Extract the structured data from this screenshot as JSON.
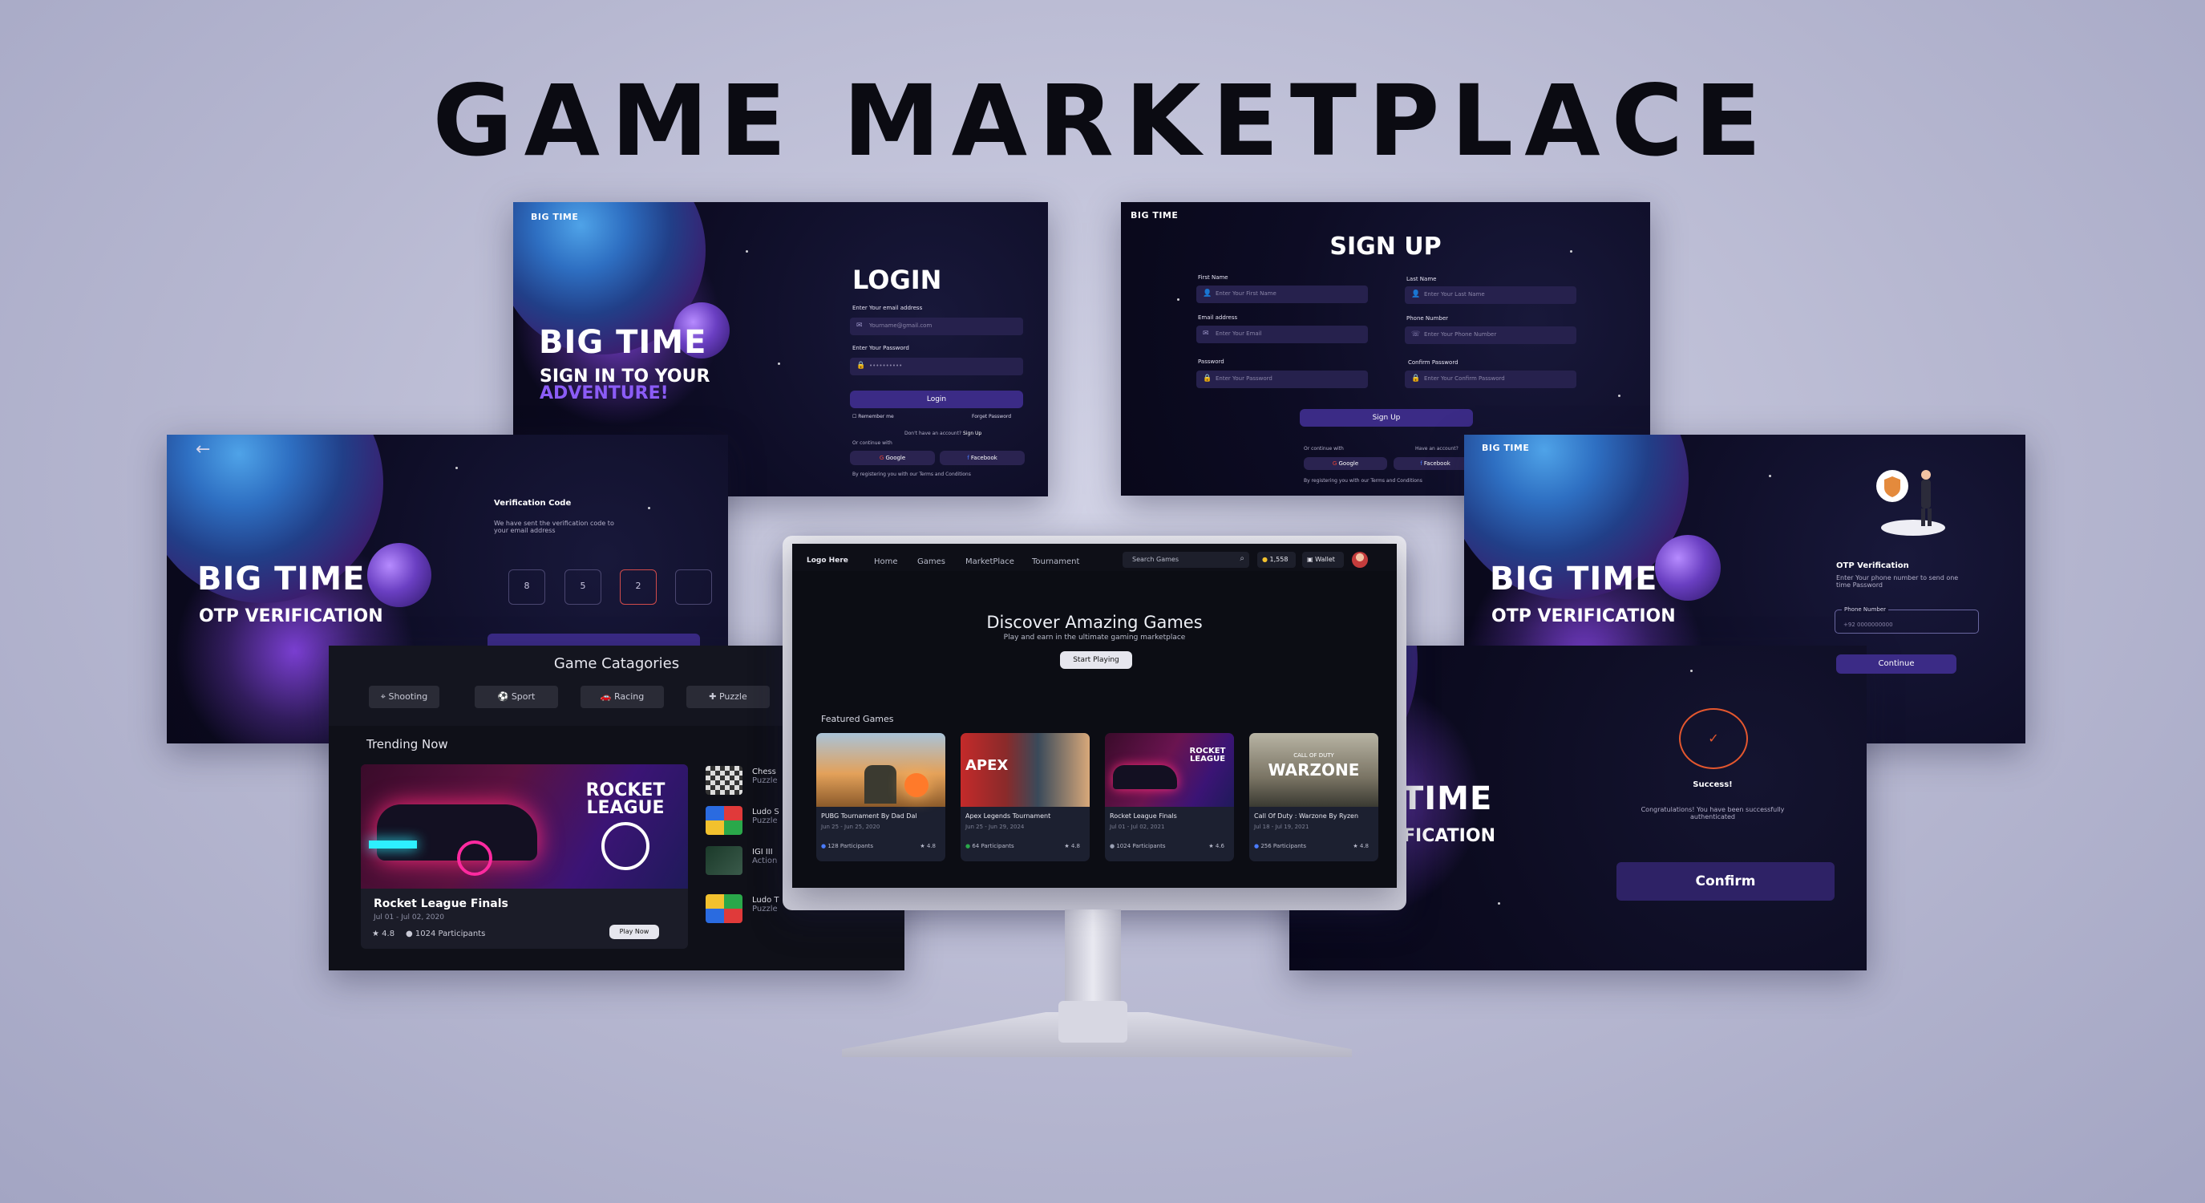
{
  "title": "GAME MARKETPLACE",
  "login": {
    "logo": "BIG TIME",
    "brand": "BIG TIME",
    "tagline1": "SIGN IN TO YOUR",
    "tagline2": "ADVENTURE!",
    "heading": "LOGIN",
    "email_label": "Enter Your email address",
    "email_value": "Yourname@gmail.com",
    "password_label": "Enter Your Password",
    "password_value": "••••••••••",
    "login_button": "Login",
    "remember": "Remember me",
    "forgot": "Forget Password",
    "no_account": "Don't have an account?",
    "signup_link": "Sign Up",
    "continue_with": "Or continue with",
    "google": "Google",
    "facebook": "Facebook",
    "terms": "By registering you with our Terms and Conditions"
  },
  "signup": {
    "logo": "BIG TIME",
    "heading": "SIGN UP",
    "first_label": "First Name",
    "first_ph": "Enter Your First Name",
    "last_label": "Last Name",
    "last_ph": "Enter Your Last Name",
    "email_label": "Email address",
    "email_ph": "Enter Your Email",
    "phone_label": "Phone Number",
    "phone_ph": "Enter Your Phone Number",
    "pass_label": "Password",
    "pass_ph": "Enter Your Password",
    "confirm_label": "Confirm Password",
    "confirm_ph": "Enter Your Confirm Password",
    "button": "Sign Up",
    "continue_with": "Or continue with",
    "have_account": "Have an account?",
    "google": "Google",
    "facebook": "Facebook",
    "terms": "By registering you with our Terms and Conditions"
  },
  "otp_left": {
    "brand": "BIG TIME",
    "subtitle": "OTP VERIFICATION",
    "code_title": "Verification Code",
    "code_desc": "We have sent the verification code to your email address",
    "digits": [
      "8",
      "5",
      "2",
      ""
    ]
  },
  "otp_right": {
    "logo": "BIG TIME",
    "brand": "BIG TIME",
    "subtitle": "OTP VERIFICATION",
    "heading": "OTP Verification",
    "desc": "Enter Your phone number to send one time Password",
    "phone_label": "Phone Number",
    "phone_ph": "+92 0000000000",
    "button": "Continue"
  },
  "categories": {
    "heading": "Game Catagories",
    "items": [
      {
        "label": "Shooting",
        "icon": "crosshair-icon"
      },
      {
        "label": "Sport",
        "icon": "football-icon"
      },
      {
        "label": "Racing",
        "icon": "car-icon"
      },
      {
        "label": "Puzzle",
        "icon": "puzzle-icon"
      }
    ],
    "trending": "Trending Now",
    "feature_title": "Rocket League Finals",
    "feature_dates": "Jul 01 - Jul 02, 2020",
    "feature_rating": "4.8",
    "feature_participants": "1024 Participants",
    "play_button": "Play Now",
    "side_items": [
      {
        "name": "Chess",
        "sub": "Puzzle"
      },
      {
        "name": "Ludo S",
        "sub": "Puzzle"
      },
      {
        "name": "IGI III",
        "sub": "Action"
      },
      {
        "name": "Ludo T",
        "sub": "Puzzle"
      }
    ]
  },
  "success": {
    "brand_part": "TIME",
    "subtitle_part": "FICATION",
    "status": "Success!",
    "message": "Congratulations! You have been successfully authenticated",
    "button": "Confirm"
  },
  "monitor": {
    "logo": "Logo Here",
    "nav": [
      "Home",
      "Games",
      "MarketPlace",
      "Tournament"
    ],
    "search_ph": "Search Games",
    "coins": "1,558",
    "wallet": "Wallet",
    "hero_title": "Discover Amazing Games",
    "hero_sub": "Play and earn in the ultimate gaming marketplace",
    "hero_button": "Start Playing",
    "featured": "Featured Games",
    "cards": [
      {
        "title": "PUBG Tournament By Dad Dal",
        "date": "Jun 25 - Jun 25, 2020",
        "participants": "128 Participants",
        "rating": "4.8"
      },
      {
        "title": "Apex Legends Tournament",
        "date": "Jun 25 - Jun 29, 2024",
        "participants": "64 Participants",
        "rating": "4.8"
      },
      {
        "title": "Rocket League Finals",
        "date": "Jul 01 - Jul 02, 2021",
        "participants": "1024 Participants",
        "rating": "4.6"
      },
      {
        "title": "Call Of Duty : Warzone By Ryzen",
        "date": "Jul 18 - Jul 19, 2021",
        "participants": "256 Participants",
        "rating": "4.8"
      }
    ]
  },
  "art": {
    "rocket": "ROCKET LEAGUE",
    "apex": "APEX",
    "warzone": "WARZONE",
    "cod": "CALL OF DUTY"
  },
  "colors": {
    "accent": "#3b2b86",
    "purple_text": "#8b5cf6",
    "success_ring": "#e4572e"
  }
}
